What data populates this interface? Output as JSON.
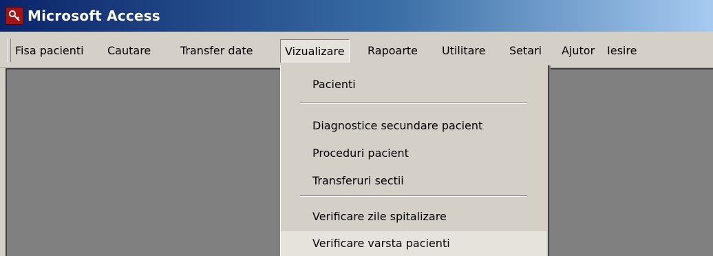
{
  "window": {
    "title": "Microsoft Access",
    "icon": "access-key-icon"
  },
  "menubar": {
    "items": [
      {
        "label": "Fisa pacienti"
      },
      {
        "label": "Cautare"
      },
      {
        "label": "Transfer date"
      },
      {
        "label": "Vizualizare"
      },
      {
        "label": "Rapoarte"
      },
      {
        "label": "Utilitare"
      },
      {
        "label": "Setari"
      },
      {
        "label": "Ajutor"
      },
      {
        "label": "Iesire"
      }
    ],
    "active": "Vizualizare"
  },
  "dropdown": {
    "items": [
      {
        "label": "Pacienti"
      },
      {
        "label": "Diagnostice secundare pacient"
      },
      {
        "label": "Proceduri pacient"
      },
      {
        "label": "Transferuri sectii"
      },
      {
        "label": "Verificare zile spitalizare"
      },
      {
        "label": "Verificare varsta pacienti"
      }
    ],
    "highlighted": "Verificare varsta pacienti"
  },
  "colors": {
    "titlebar_start": "#0a246a",
    "titlebar_end": "#a6caf0",
    "face": "#d4d0c8",
    "client": "#808080"
  }
}
